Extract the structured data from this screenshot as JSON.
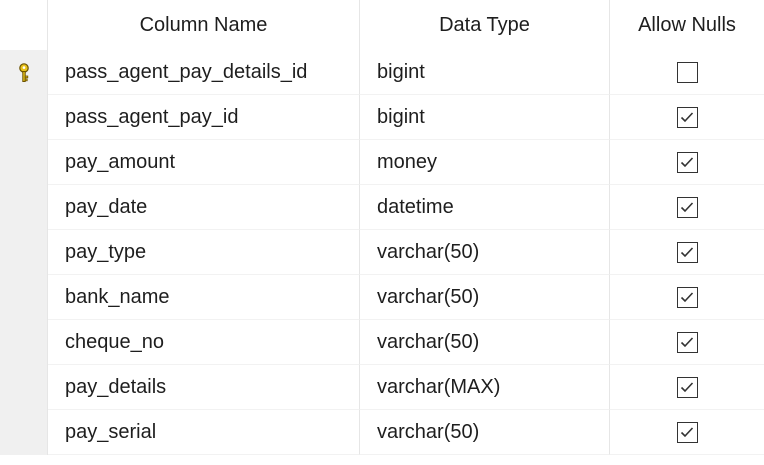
{
  "headers": {
    "column_name": "Column Name",
    "data_type": "Data Type",
    "allow_nulls": "Allow Nulls"
  },
  "rows": [
    {
      "name": "pass_agent_pay_details_id",
      "type": "bigint",
      "allow_nulls": false,
      "primary_key": true
    },
    {
      "name": "pass_agent_pay_id",
      "type": "bigint",
      "allow_nulls": true,
      "primary_key": false
    },
    {
      "name": "pay_amount",
      "type": "money",
      "allow_nulls": true,
      "primary_key": false
    },
    {
      "name": "pay_date",
      "type": "datetime",
      "allow_nulls": true,
      "primary_key": false
    },
    {
      "name": "pay_type",
      "type": "varchar(50)",
      "allow_nulls": true,
      "primary_key": false
    },
    {
      "name": "bank_name",
      "type": "varchar(50)",
      "allow_nulls": true,
      "primary_key": false
    },
    {
      "name": "cheque_no",
      "type": "varchar(50)",
      "allow_nulls": true,
      "primary_key": false
    },
    {
      "name": "pay_details",
      "type": "varchar(MAX)",
      "allow_nulls": true,
      "primary_key": false
    },
    {
      "name": "pay_serial",
      "type": "varchar(50)",
      "allow_nulls": true,
      "primary_key": false
    }
  ],
  "icons": {
    "primary_key": "key-icon",
    "checkbox_checked": "checkbox-checked-icon",
    "checkbox_unchecked": "checkbox-unchecked-icon"
  },
  "colors": {
    "key_gold": "#e8c21a",
    "row_selector_bg": "#f0f0f0",
    "grid_line": "#e6e6e6"
  }
}
